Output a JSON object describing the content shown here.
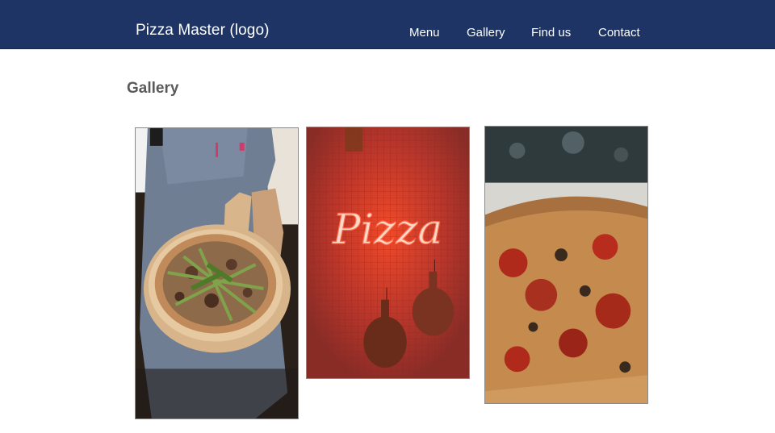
{
  "header": {
    "logo_text": "Pizza Master (logo)",
    "nav": [
      {
        "label": "Menu"
      },
      {
        "label": "Gallery"
      },
      {
        "label": "Find us"
      },
      {
        "label": "Contact"
      }
    ]
  },
  "gallery": {
    "title": "Gallery",
    "photos": [
      {
        "subject": "chef-holding-pizza"
      },
      {
        "subject": "neon-sign",
        "sign_text": "Pizza"
      },
      {
        "subject": "pizza-closeup"
      }
    ]
  },
  "colors": {
    "header_bg": "#1e3464",
    "title_text": "#5a5a5a",
    "neon": "#ff5a3c"
  }
}
